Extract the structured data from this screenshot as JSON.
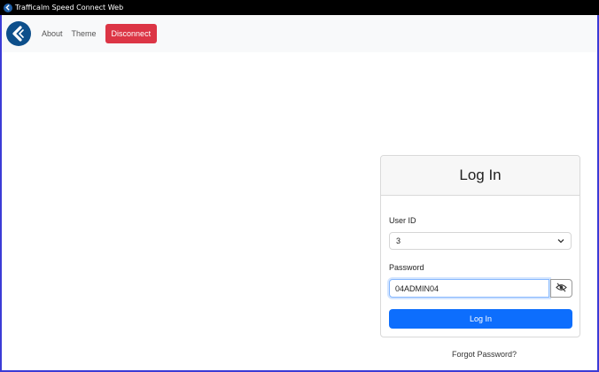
{
  "window": {
    "title": "Trafficalm Speed Connect Web"
  },
  "navbar": {
    "about": "About",
    "theme": "Theme",
    "disconnect": "Disconnect"
  },
  "login": {
    "title": "Log In",
    "user_id_label": "User ID",
    "user_id_value": "3",
    "password_label": "Password",
    "password_value": "04ADMIN04",
    "submit_label": "Log In",
    "forgot_label": "Forgot Password?"
  },
  "colors": {
    "primary": "#0d6efd",
    "danger": "#dc3545",
    "logo": "#0d4f8b",
    "navbar_bg": "#f8f9fa"
  },
  "icons": {
    "logo": "trafficalm-logo-icon",
    "select": "chevron-down-icon",
    "password_toggle": "eye-slash-icon"
  }
}
